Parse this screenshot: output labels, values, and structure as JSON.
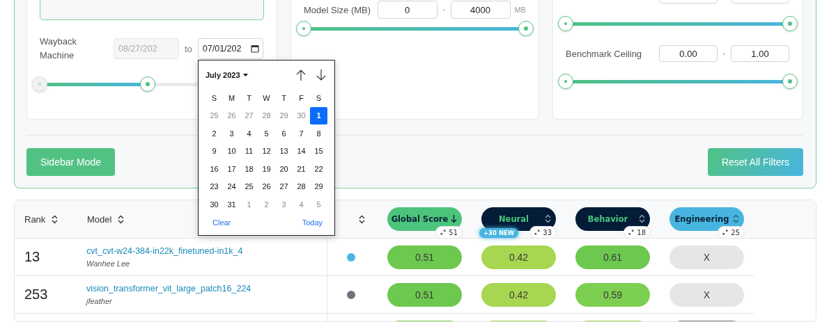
{
  "filters": {
    "wayback": {
      "label": "Wayback Machine",
      "start": {
        "value": "08/27/202",
        "disabled": true
      },
      "separator": "to",
      "end": {
        "value": "07/01/202",
        "disabled": false
      },
      "slider": {
        "level": 0.48
      }
    },
    "model_size": {
      "label": "Model Size (MB)",
      "min": "0",
      "separator": "-",
      "max": "4000",
      "unit": "MB",
      "slider": {
        "level": 1
      }
    },
    "score_range": {
      "slider": {
        "level": 1
      }
    },
    "benchmark_ceiling": {
      "label": "Benchmark Ceiling",
      "min": "0.00",
      "separator": "-",
      "max": "1.00",
      "slider": {
        "level": 1
      }
    },
    "buttons": [
      {
        "label": "Sidebar Mode",
        "kind": "solid"
      },
      {
        "label": "Reset All Filters",
        "kind": "gradient"
      }
    ]
  },
  "date_picker": {
    "month": "July 2023",
    "weekdays": [
      "S",
      "M",
      "T",
      "W",
      "T",
      "F",
      "S"
    ],
    "weeks": [
      [
        {
          "day": "25",
          "outside": true,
          "selected": false
        },
        {
          "day": "26",
          "outside": true,
          "selected": false
        },
        {
          "day": "27",
          "outside": true,
          "selected": false
        },
        {
          "day": "28",
          "outside": true,
          "selected": false
        },
        {
          "day": "29",
          "outside": true,
          "selected": false
        },
        {
          "day": "30",
          "outside": true,
          "selected": false
        },
        {
          "day": "1",
          "outside": false,
          "selected": true
        }
      ],
      [
        {
          "day": "2",
          "outside": false,
          "selected": false
        },
        {
          "day": "3",
          "outside": false,
          "selected": false
        },
        {
          "day": "4",
          "outside": false,
          "selected": false
        },
        {
          "day": "5",
          "outside": false,
          "selected": false
        },
        {
          "day": "6",
          "outside": false,
          "selected": false
        },
        {
          "day": "7",
          "outside": false,
          "selected": false
        },
        {
          "day": "8",
          "outside": false,
          "selected": false
        }
      ],
      [
        {
          "day": "9",
          "outside": false,
          "selected": false
        },
        {
          "day": "10",
          "outside": false,
          "selected": false
        },
        {
          "day": "11",
          "outside": false,
          "selected": false
        },
        {
          "day": "12",
          "outside": false,
          "selected": false
        },
        {
          "day": "13",
          "outside": false,
          "selected": false
        },
        {
          "day": "14",
          "outside": false,
          "selected": false
        },
        {
          "day": "15",
          "outside": false,
          "selected": false
        }
      ],
      [
        {
          "day": "16",
          "outside": false,
          "selected": false
        },
        {
          "day": "17",
          "outside": false,
          "selected": false
        },
        {
          "day": "18",
          "outside": false,
          "selected": false
        },
        {
          "day": "19",
          "outside": false,
          "selected": false
        },
        {
          "day": "20",
          "outside": false,
          "selected": false
        },
        {
          "day": "21",
          "outside": false,
          "selected": false
        },
        {
          "day": "22",
          "outside": false,
          "selected": false
        }
      ],
      [
        {
          "day": "23",
          "outside": false,
          "selected": false
        },
        {
          "day": "24",
          "outside": false,
          "selected": false
        },
        {
          "day": "25",
          "outside": false,
          "selected": false
        },
        {
          "day": "26",
          "outside": false,
          "selected": false
        },
        {
          "day": "27",
          "outside": false,
          "selected": false
        },
        {
          "day": "28",
          "outside": false,
          "selected": false
        },
        {
          "day": "29",
          "outside": false,
          "selected": false
        }
      ],
      [
        {
          "day": "30",
          "outside": false,
          "selected": false
        },
        {
          "day": "31",
          "outside": false,
          "selected": false
        },
        {
          "day": "1",
          "outside": true,
          "selected": false
        },
        {
          "day": "2",
          "outside": true,
          "selected": false
        },
        {
          "day": "3",
          "outside": true,
          "selected": false
        },
        {
          "day": "4",
          "outside": true,
          "selected": false
        },
        {
          "day": "5",
          "outside": true,
          "selected": false
        }
      ]
    ],
    "clear": "Clear",
    "today": "Today"
  },
  "table": {
    "columns": [
      {
        "label": "Rank",
        "kind": "text"
      },
      {
        "label": "Model",
        "kind": "text"
      },
      {
        "kind": "icon"
      },
      {
        "label": "Global Score",
        "kind": "score",
        "color": "#4cc47c",
        "sorted": true,
        "count": "51"
      },
      {
        "label": "Neural",
        "kind": "score",
        "color": "#041c37",
        "sorted": false,
        "count": "33",
        "badge": "+30 NEW"
      },
      {
        "label": "Behavior",
        "kind": "score",
        "color": "#041c37",
        "sorted": false,
        "count": "18"
      },
      {
        "label": "Engineering",
        "kind": "score",
        "color": "#48b5e0",
        "sorted": false,
        "count": "25"
      }
    ],
    "rows": [
      {
        "rank": "13",
        "model": "cvt_cvt-w24-384-in22k_finetuned-in1k_4",
        "author": "Wanhee Lee",
        "color": "#4bb6e0",
        "scores": [
          {
            "value": "0.51",
            "color": "#6cc84f"
          },
          {
            "value": "0.42",
            "color": "#a7d651"
          },
          {
            "value": "0.61",
            "color": "#6cc84f"
          },
          {
            "value": "X",
            "color": "#e6e6e6"
          }
        ]
      },
      {
        "rank": "253",
        "model": "vision_transformer_vit_large_patch16_224",
        "author": "jfeather",
        "color": "#6c757d",
        "scores": [
          {
            "value": "0.51",
            "color": "#6cc84f"
          },
          {
            "value": "0.42",
            "color": "#a7d651"
          },
          {
            "value": "0.59",
            "color": "#7ccf50"
          },
          {
            "value": "X",
            "color": "#e6e6e6"
          }
        ]
      },
      {
        "scores": [
          {
            "color": "#7ccf50"
          },
          {
            "color": "#a7d651"
          },
          {
            "color": "#a7d651"
          },
          {
            "color": "#7a7a7a"
          }
        ]
      }
    ]
  }
}
